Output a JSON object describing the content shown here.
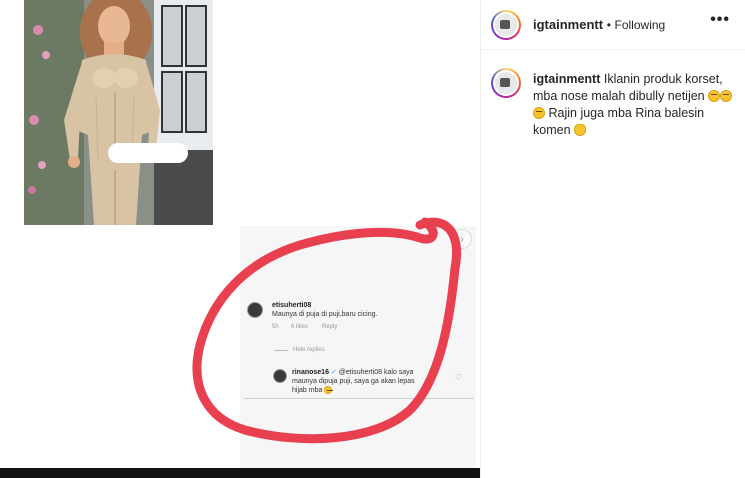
{
  "post": {
    "username": "igtainmentt",
    "separator": "•",
    "follow_status": "Following",
    "more_label": "•••",
    "caption_part1": "Iklanin produk korset, mba nose malah dibully netijen",
    "caption_part2": "Rajin juga mba Rina balesin komen"
  },
  "embedded_screenshot": {
    "next_arrow": "›",
    "comment1": {
      "user": "etisuherti08",
      "text": "Maunya di puja di puji,baru cicing.",
      "time": "5h",
      "likes": "6 likes",
      "reply": "Reply"
    },
    "hide_replies": "Hide replies",
    "comment2": {
      "user": "rinanose16",
      "verified": "✓",
      "text_line1": "@etisuherti08 kalo saya",
      "text_line2": "maunya dipuja puji, saya ga akan lepas",
      "text_line3": "hijab mba"
    },
    "heart": "♡"
  },
  "colors": {
    "annotation_circle": "#e8404f",
    "story_ring": [
      "#feda75",
      "#fa7e1e",
      "#d62976",
      "#962fbf",
      "#4f5bd5"
    ]
  }
}
